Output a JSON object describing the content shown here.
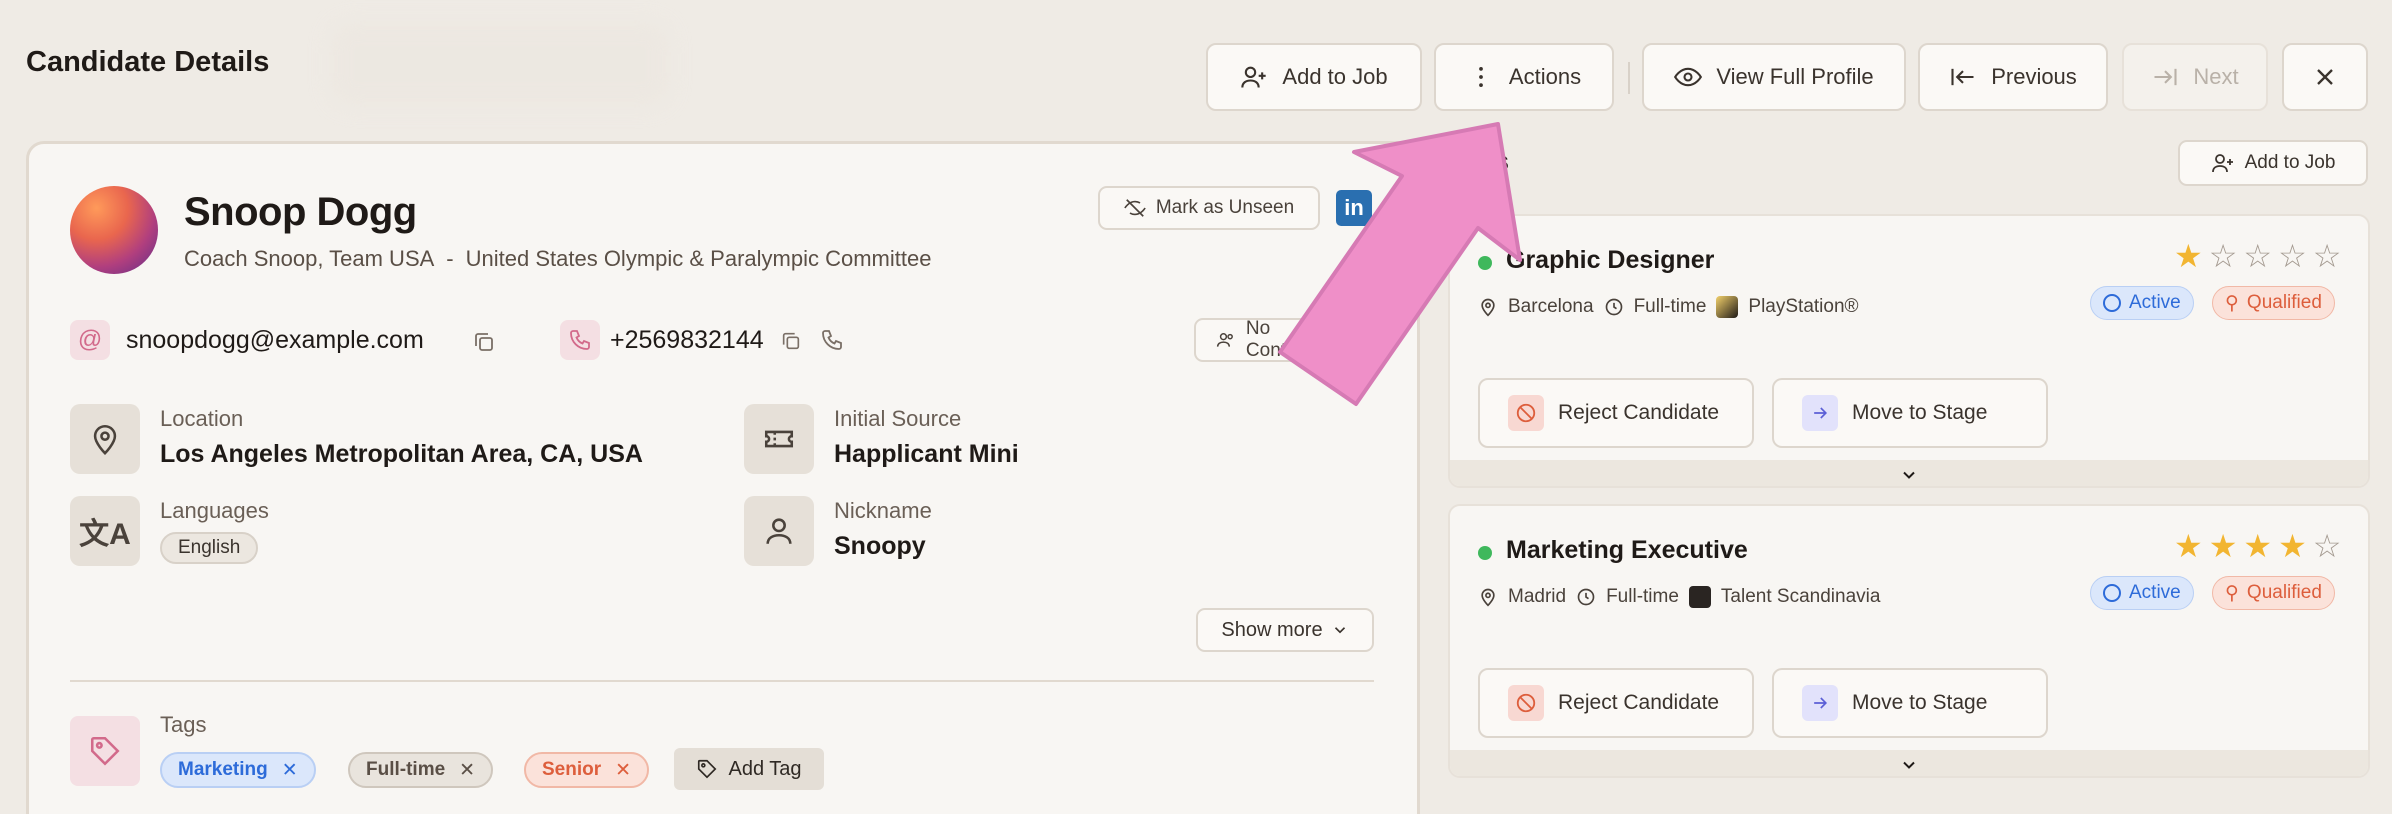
{
  "header": {
    "title": "Candidate Details",
    "add_to_job": "Add to Job",
    "actions": "Actions",
    "view_full_profile": "View Full Profile",
    "previous": "Previous",
    "next": "Next"
  },
  "candidate": {
    "name": "Snoop Dogg",
    "role": "Coach Snoop, Team USA",
    "separator": "-",
    "organization": "United States Olympic & Paralympic Committee",
    "mark_unseen": "Mark as Unseen",
    "linkedin": "in",
    "email": "snoopdogg@example.com",
    "phone": "+2569832144",
    "no_contact": "No Contact",
    "location_label": "Location",
    "location_value": "Los Angeles Metropolitan Area, CA, USA",
    "source_label": "Initial Source",
    "source_value": "Happlicant Mini",
    "languages_label": "Languages",
    "languages": [
      "English"
    ],
    "nickname_label": "Nickname",
    "nickname_value": "Snoopy",
    "show_more": "Show more",
    "tags_label": "Tags",
    "tags": [
      {
        "label": "Marketing",
        "color": "#2d6bd9"
      },
      {
        "label": "Full-time",
        "color": "#5a4f46"
      },
      {
        "label": "Senior",
        "color": "#dd5e3c"
      }
    ],
    "add_tag": "Add Tag"
  },
  "jobs": {
    "header_fragment": "s",
    "add_to_job": "Add to Job",
    "items": [
      {
        "title": "Graphic Designer",
        "location": "Barcelona",
        "type": "Full-time",
        "company": "PlayStation®",
        "rating": 1,
        "status": "Active",
        "stage": "Qualified",
        "reject": "Reject Candidate",
        "move": "Move to Stage"
      },
      {
        "title": "Marketing Executive",
        "location": "Madrid",
        "type": "Full-time",
        "company": "Talent Scandinavia",
        "rating": 4,
        "status": "Active",
        "stage": "Qualified",
        "reject": "Reject Candidate",
        "move": "Move to Stage"
      }
    ]
  },
  "colors": {
    "accent_pink": "#ef8fc8",
    "active_blue": "#2d6bd9",
    "qualified_orange": "#dd5e3c",
    "star_gold": "#f2b531"
  }
}
